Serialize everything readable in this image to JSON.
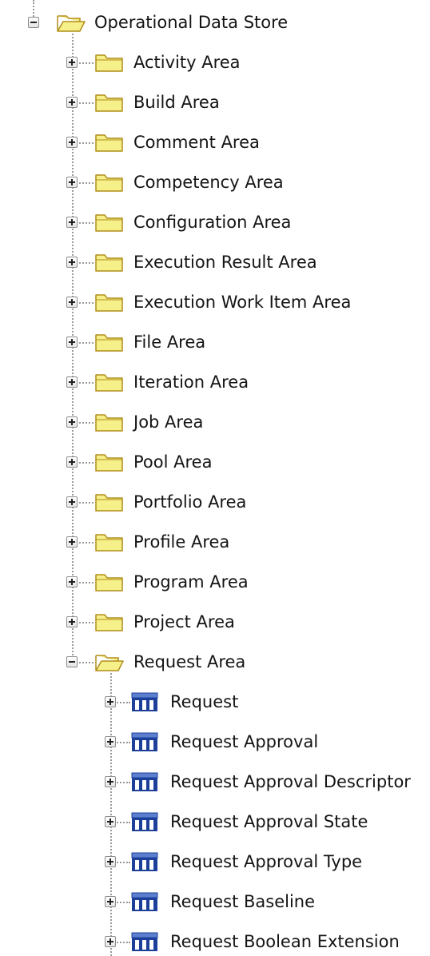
{
  "tree": {
    "root": {
      "label": "Operational Data Store",
      "expanded": true,
      "icon": "folder-open-icon"
    },
    "folders": [
      {
        "label": "Activity Area",
        "expanded": false
      },
      {
        "label": "Build Area",
        "expanded": false
      },
      {
        "label": "Comment Area",
        "expanded": false
      },
      {
        "label": "Competency Area",
        "expanded": false
      },
      {
        "label": "Configuration Area",
        "expanded": false
      },
      {
        "label": "Execution Result Area",
        "expanded": false
      },
      {
        "label": "Execution Work Item Area",
        "expanded": false
      },
      {
        "label": "File Area",
        "expanded": false
      },
      {
        "label": "Iteration Area",
        "expanded": false
      },
      {
        "label": "Job Area",
        "expanded": false
      },
      {
        "label": "Pool Area",
        "expanded": false
      },
      {
        "label": "Portfolio Area",
        "expanded": false
      },
      {
        "label": "Profile Area",
        "expanded": false
      },
      {
        "label": "Program Area",
        "expanded": false
      },
      {
        "label": "Project Area",
        "expanded": false
      },
      {
        "label": "Request Area",
        "expanded": true
      }
    ],
    "tables": [
      {
        "label": "Request"
      },
      {
        "label": "Request Approval"
      },
      {
        "label": "Request Approval Descriptor"
      },
      {
        "label": "Request Approval State"
      },
      {
        "label": "Request Approval Type"
      },
      {
        "label": "Request Baseline"
      },
      {
        "label": "Request Boolean Extension"
      }
    ]
  },
  "colors": {
    "folder_fill": "#f6f08a",
    "folder_stroke": "#b08d1a",
    "table_fill": "#1c3f9a",
    "table_header": "#5d7fd0",
    "line": "#9a9a9a"
  }
}
